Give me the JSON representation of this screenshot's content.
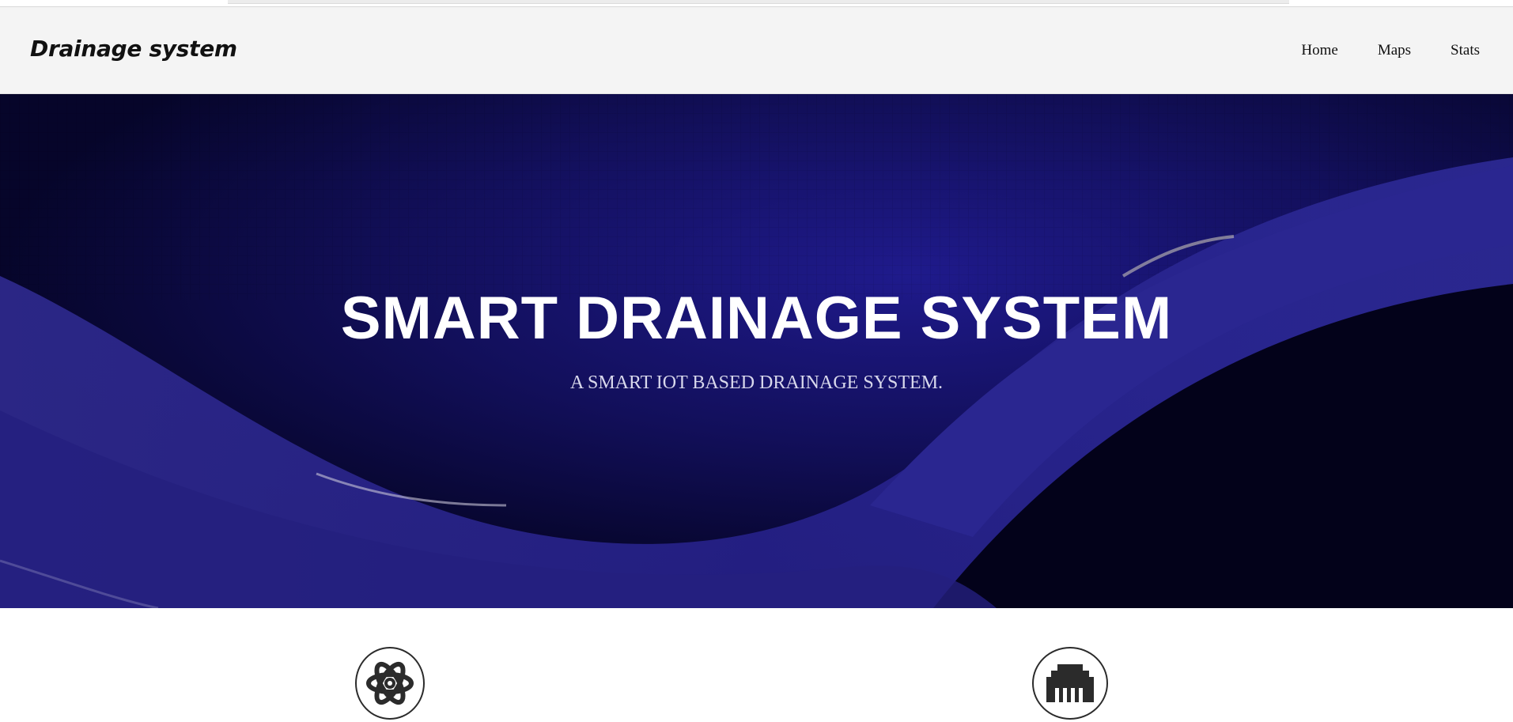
{
  "header": {
    "brand": "Drainage system",
    "nav": [
      {
        "label": "Home"
      },
      {
        "label": "Maps"
      },
      {
        "label": "Stats"
      }
    ]
  },
  "hero": {
    "title": "SMART DRAINAGE SYSTEM",
    "subtitle": "A SMART IOT BASED DRAINAGE SYSTEM."
  },
  "features": [
    {
      "icon": "atom-icon"
    },
    {
      "icon": "ethernet-port-icon"
    }
  ],
  "colors": {
    "navbar_bg": "#f4f4f4",
    "hero_dark": "#0b0a3a",
    "hero_accent": "#2b2790",
    "text_white": "#ffffff"
  }
}
